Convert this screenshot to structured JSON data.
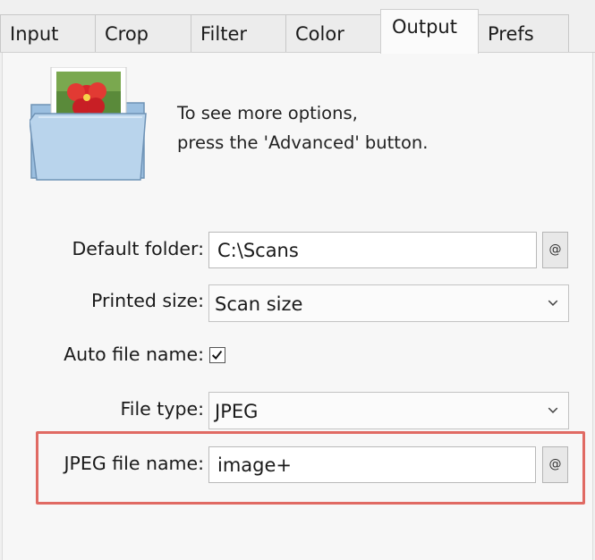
{
  "tabs": [
    {
      "label": "Input",
      "active": false
    },
    {
      "label": "Crop",
      "active": false
    },
    {
      "label": "Filter",
      "active": false
    },
    {
      "label": "Color",
      "active": false
    },
    {
      "label": "Output",
      "active": true
    },
    {
      "label": "Prefs",
      "active": false
    }
  ],
  "hint": {
    "line1": "To see more options,",
    "line2": "press the 'Advanced' button."
  },
  "fields": {
    "default_folder": {
      "label": "Default folder:",
      "value": "C:\\Scans",
      "button": "@"
    },
    "printed_size": {
      "label": "Printed size:",
      "value": "Scan size"
    },
    "auto_file_name": {
      "label": "Auto file name:",
      "checked": true
    },
    "file_type": {
      "label": "File type:",
      "value": "JPEG"
    },
    "jpeg_file_name": {
      "label": "JPEG file name:",
      "value": "image+",
      "button": "@"
    }
  },
  "colors": {
    "highlight": "#e06a63",
    "folder_blue": "#a9c9e6",
    "flower_red": "#d8262b"
  },
  "icons": {
    "folder": "folder-with-photo-icon",
    "dropdown": "chevron-down-icon",
    "check": "checkmark-icon"
  }
}
